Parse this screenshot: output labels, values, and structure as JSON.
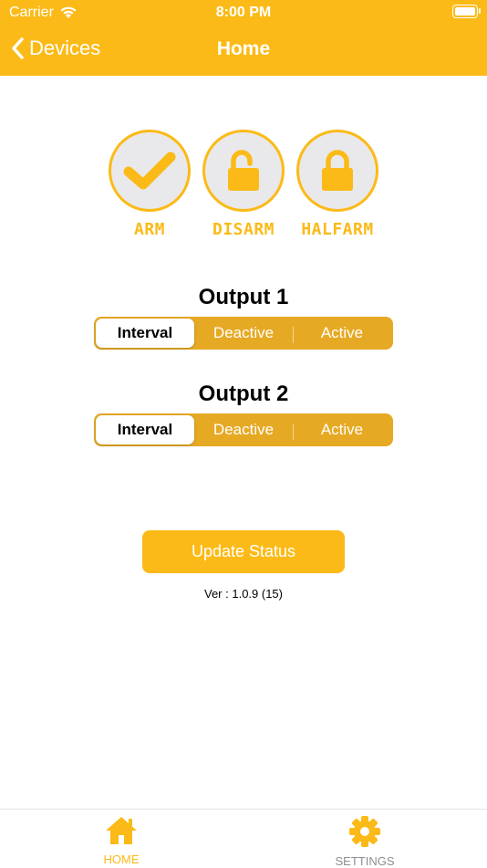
{
  "status_bar": {
    "carrier": "Carrier",
    "time": "8:00 PM"
  },
  "nav": {
    "back_label": "Devices",
    "title": "Home"
  },
  "modes": [
    {
      "label": "ARM",
      "icon": "check-icon"
    },
    {
      "label": "DISARM",
      "icon": "unlock-icon"
    },
    {
      "label": "HALFARM",
      "icon": "lock-icon"
    }
  ],
  "outputs": [
    {
      "title": "Output 1",
      "segments": [
        "Interval",
        "Deactive",
        "Active"
      ],
      "selected": "Interval"
    },
    {
      "title": "Output 2",
      "segments": [
        "Interval",
        "Deactive",
        "Active"
      ],
      "selected": "Interval"
    }
  ],
  "update_button": "Update Status",
  "version": "Ver : 1.0.9 (15)",
  "tabbar": [
    {
      "label": "HOME",
      "icon": "home-icon",
      "active": true
    },
    {
      "label": "SETTINGS",
      "icon": "gear-icon",
      "active": false
    }
  ],
  "colors": {
    "accent": "#FBBA17",
    "segment_bg": "#E6A924",
    "circle_fill": "#E9E9EB",
    "inactive_tab": "#8E8E93"
  }
}
